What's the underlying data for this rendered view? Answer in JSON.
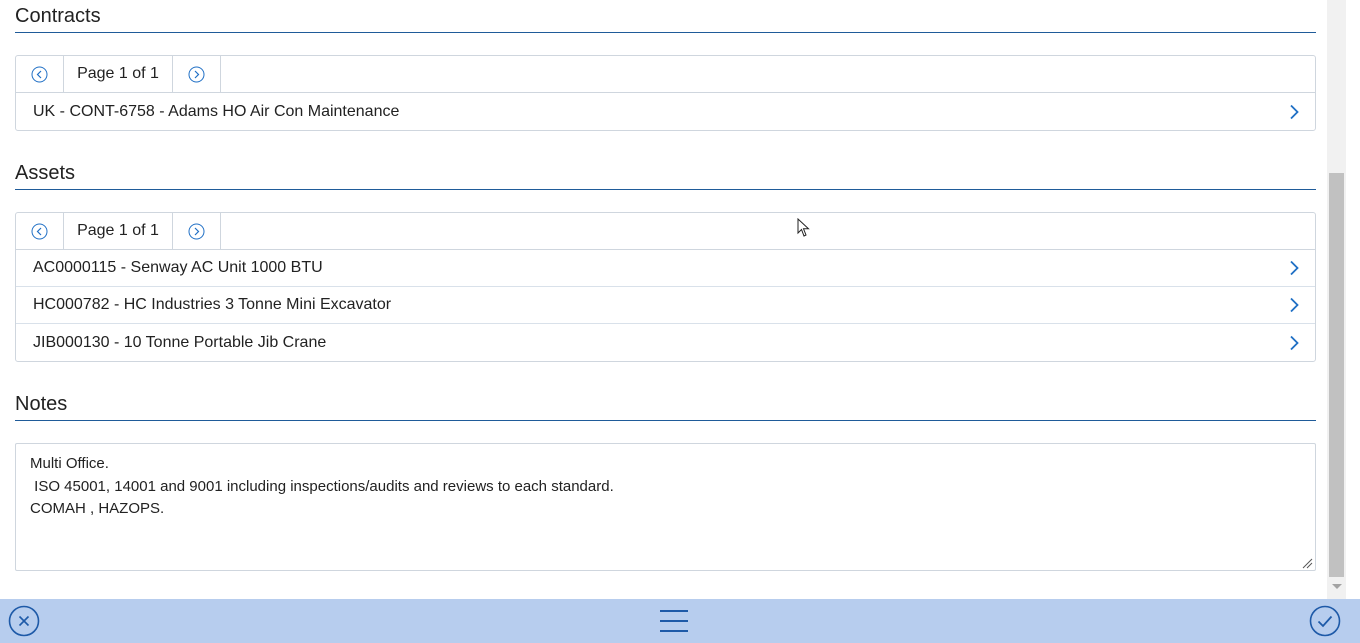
{
  "contracts": {
    "title": "Contracts",
    "pager_text": "Page 1 of 1",
    "items": [
      {
        "label": "UK - CONT-6758 - Adams HO Air Con Maintenance"
      }
    ]
  },
  "assets": {
    "title": "Assets",
    "pager_text": "Page 1 of 1",
    "items": [
      {
        "label": "AC0000115 - Senway AC Unit 1000 BTU"
      },
      {
        "label": "HC000782 - HC Industries 3 Tonne Mini Excavator"
      },
      {
        "label": "JIB000130 - 10 Tonne Portable Jib Crane"
      }
    ]
  },
  "notes": {
    "title": "Notes",
    "value": "Multi Office.\n ISO 45001, 14001 and 9001 including inspections/audits and reviews to each standard.\nCOMAH , HAZOPS."
  },
  "colors": {
    "accent": "#1f6fc5",
    "section_rule": "#1f5b99",
    "bottom_bar": "#b7cdee"
  },
  "icons": {
    "prev": "circle-chevron-left-icon",
    "next": "circle-chevron-right-icon",
    "row_arrow": "chevron-right-icon",
    "cancel": "circle-x-icon",
    "menu": "hamburger-menu-icon",
    "confirm": "circle-check-icon"
  }
}
